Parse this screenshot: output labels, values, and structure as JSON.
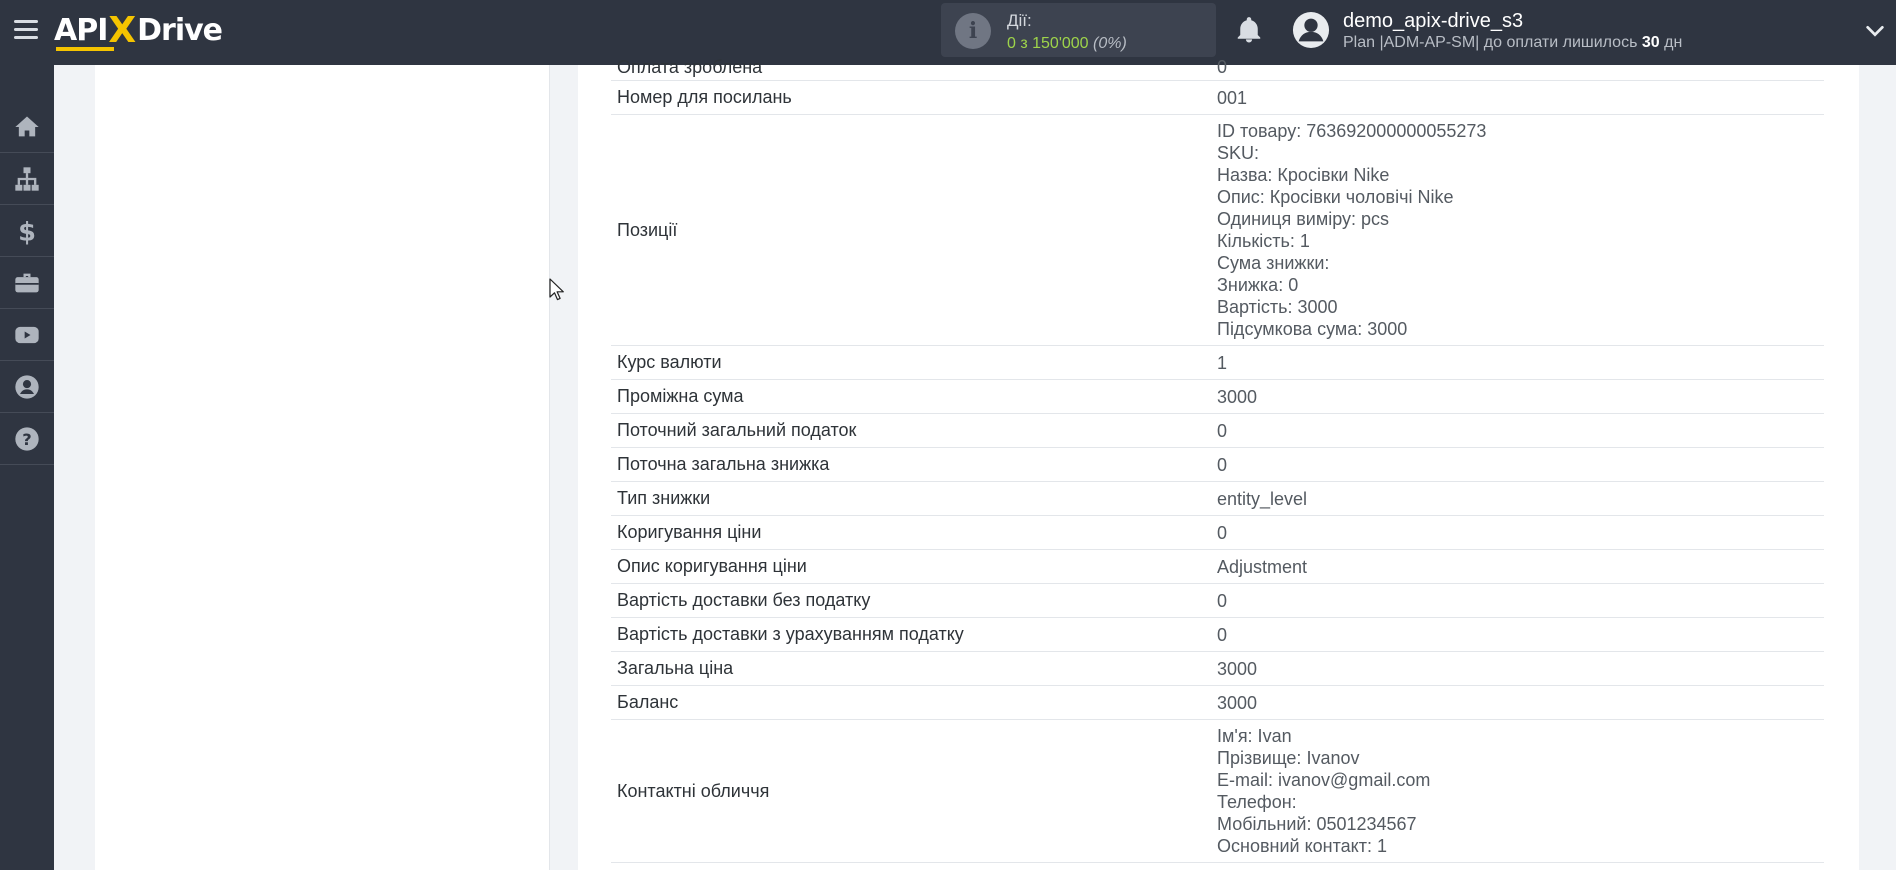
{
  "header": {
    "logo": {
      "part1": "API",
      "x": "X",
      "part2": "Drive"
    },
    "actions": {
      "label": "Дії:",
      "count": "0 з 150'000",
      "percent": "(0%)"
    },
    "user": {
      "name": "demo_apix-drive_s3",
      "plan_prefix": "Plan |ADM-AP-SM| до оплати лишилось",
      "days": "30",
      "days_unit": "дн"
    },
    "icons": [
      "menu-icon",
      "info-icon",
      "bell-icon",
      "user-avatar-icon",
      "chevron-down-icon"
    ]
  },
  "sidebar": {
    "items": [
      {
        "icon": "home-icon"
      },
      {
        "icon": "sitemap-icon"
      },
      {
        "icon": "dollar-icon"
      },
      {
        "icon": "briefcase-icon"
      },
      {
        "icon": "youtube-icon"
      },
      {
        "icon": "user-circle-icon"
      },
      {
        "icon": "help-icon"
      }
    ]
  },
  "rows": [
    {
      "key": "Оплата зроблена",
      "values": [
        "0"
      ]
    },
    {
      "key": "Номер для посилань",
      "values": [
        "001"
      ]
    },
    {
      "key": "Позиції",
      "values": [
        "ID товару: 763692000000055273",
        "SKU:",
        "Назва: Кросівки Nike",
        "Опис: Кросівки чоловічі Nike",
        "Одиниця виміру: pcs",
        "Кількість: 1",
        "Сума знижки:",
        "Знижка: 0",
        "Вартість: 3000",
        "Підсумкова сума: 3000"
      ]
    },
    {
      "key": "Курс валюти",
      "values": [
        "1"
      ]
    },
    {
      "key": "Проміжна сума",
      "values": [
        "3000"
      ]
    },
    {
      "key": "Поточний загальний податок",
      "values": [
        "0"
      ]
    },
    {
      "key": "Поточна загальна знижка",
      "values": [
        "0"
      ]
    },
    {
      "key": "Тип знижки",
      "values": [
        "entity_level"
      ]
    },
    {
      "key": "Коригування ціни",
      "values": [
        "0"
      ]
    },
    {
      "key": "Опис коригування ціни",
      "values": [
        "Adjustment"
      ]
    },
    {
      "key": "Вартість доставки без податку",
      "values": [
        "0"
      ]
    },
    {
      "key": "Вартість доставки з урахуванням податку",
      "values": [
        "0"
      ]
    },
    {
      "key": "Загальна ціна",
      "values": [
        "3000"
      ]
    },
    {
      "key": "Баланс",
      "values": [
        "3000"
      ]
    },
    {
      "key": "Контактні обличчя",
      "values": [
        "Ім'я: Ivan",
        "Прізвище: Ivanov",
        "E-mail: ivanov@gmail.com",
        "Телефон:",
        "Мобільний: 0501234567",
        "Основний контакт: 1"
      ]
    }
  ]
}
